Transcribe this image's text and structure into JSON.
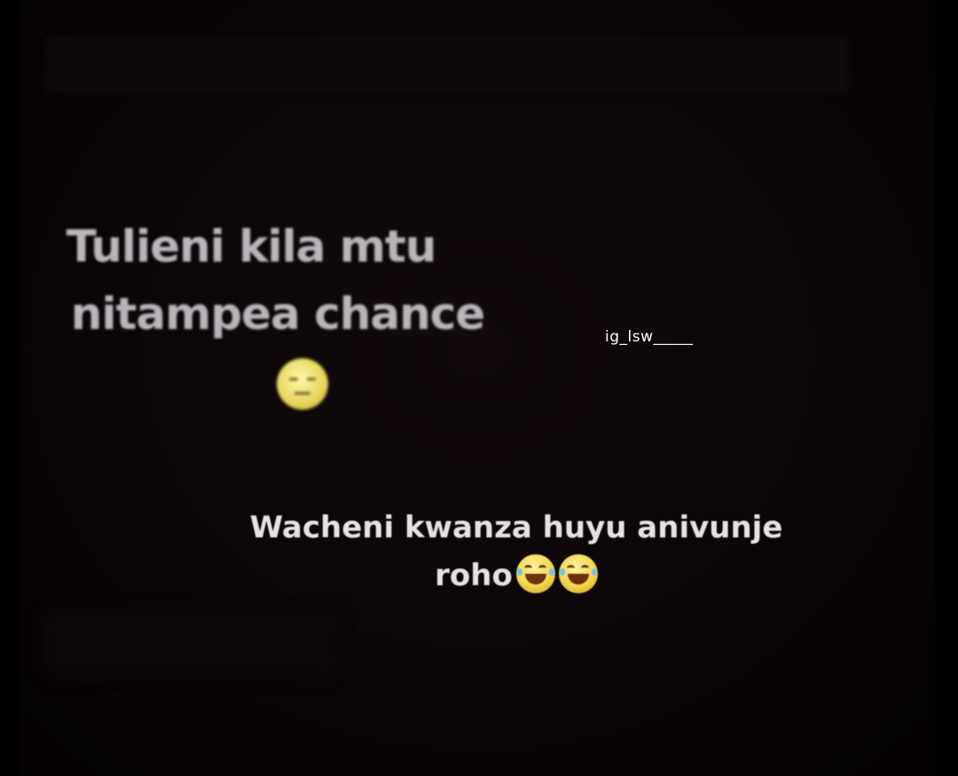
{
  "message_left": {
    "line1": "Tulieni kila mtu",
    "line2": "nitampea chance",
    "emoji": "unamused-face-icon"
  },
  "watermark": "ig_lsw_____",
  "message_right": {
    "line1": "Wacheni kwanza huyu anivunje",
    "line2": "roho",
    "emojis": [
      "tears-of-joy-icon",
      "tears-of-joy-icon"
    ]
  },
  "colors": {
    "background": "#050204",
    "text_left": "#b9b6bb",
    "text_right": "#e4e2e6",
    "watermark": "#ffffff"
  }
}
